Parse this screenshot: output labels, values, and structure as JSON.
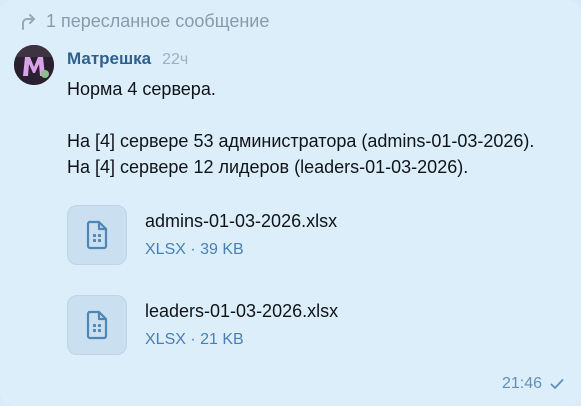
{
  "forward": {
    "icon": "forward-arrow-icon",
    "label": "1 пересланное сообщение"
  },
  "message": {
    "sender": "Матрешка",
    "sent_ago": "22ч",
    "lines": [
      "Норма 4 сервера.",
      "",
      "На [4] сервере 53 администратора (admins-01-03-2026).",
      "На [4] сервере 12 лидеров (leaders-01-03-2026)."
    ]
  },
  "attachments": [
    {
      "name": "admins-01-03-2026.xlsx",
      "meta": "XLSX · 39 KB",
      "icon": "document-icon"
    },
    {
      "name": "leaders-01-03-2026.xlsx",
      "meta": "XLSX · 21 KB",
      "icon": "document-icon"
    }
  ],
  "footer": {
    "time": "21:46",
    "status_icon": "read-check-icon"
  },
  "colors": {
    "bubble": "#dbeefa",
    "sender": "#2f5f8e",
    "link_meta": "#4a7fb3",
    "icon_tile": "#cadfef"
  }
}
